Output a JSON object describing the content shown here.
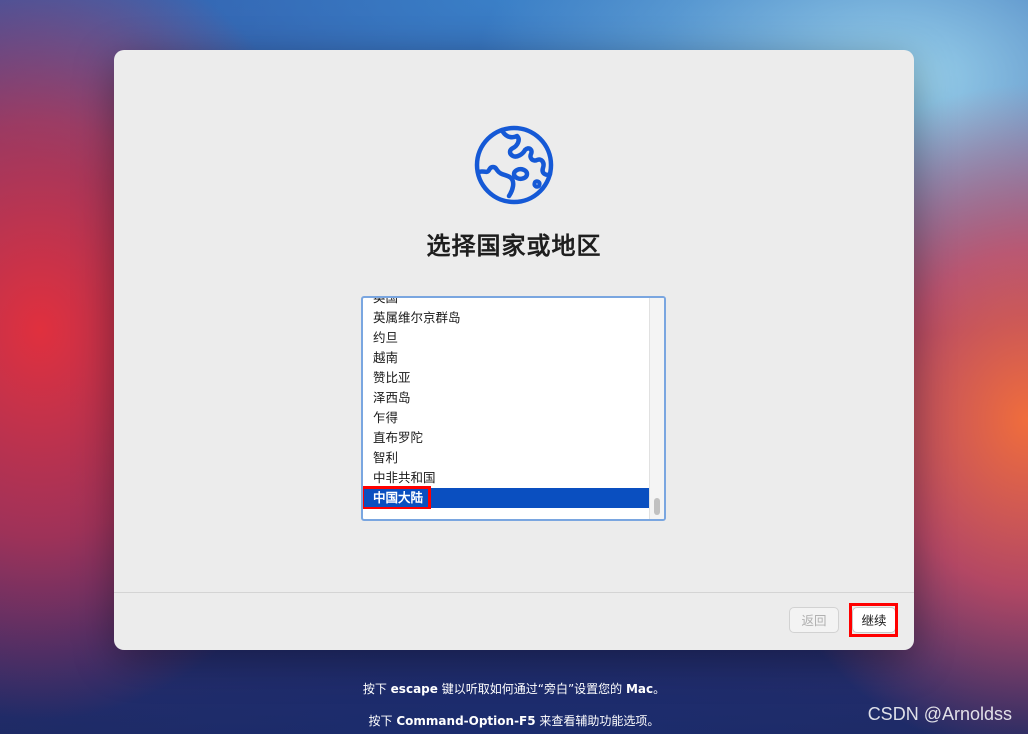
{
  "setup": {
    "title": "选择国家或地区",
    "countries": [
      "英国",
      "英属维尔京群岛",
      "约旦",
      "越南",
      "赞比亚",
      "泽西岛",
      "乍得",
      "直布罗陀",
      "智利",
      "中非共和国",
      "中国大陆"
    ],
    "selected": "中国大陆"
  },
  "buttons": {
    "back": "返回",
    "continue": "继续"
  },
  "hints": {
    "line1_a": "按下 ",
    "line1_key": "escape",
    "line1_b": " 键以听取如何通过“旁白”设置您的 ",
    "line1_mac": "Mac",
    "line1_c": "。",
    "line2_a": "按下 ",
    "line2_key": "Command-Option-F5",
    "line2_b": " 来查看辅助功能选项。"
  },
  "watermark": "CSDN @Arnoldss",
  "colors": {
    "accent": "#0a4fc0",
    "globe": "#1559d6",
    "highlight": "#ff0000"
  },
  "icons": {
    "globe": "globe-icon"
  }
}
